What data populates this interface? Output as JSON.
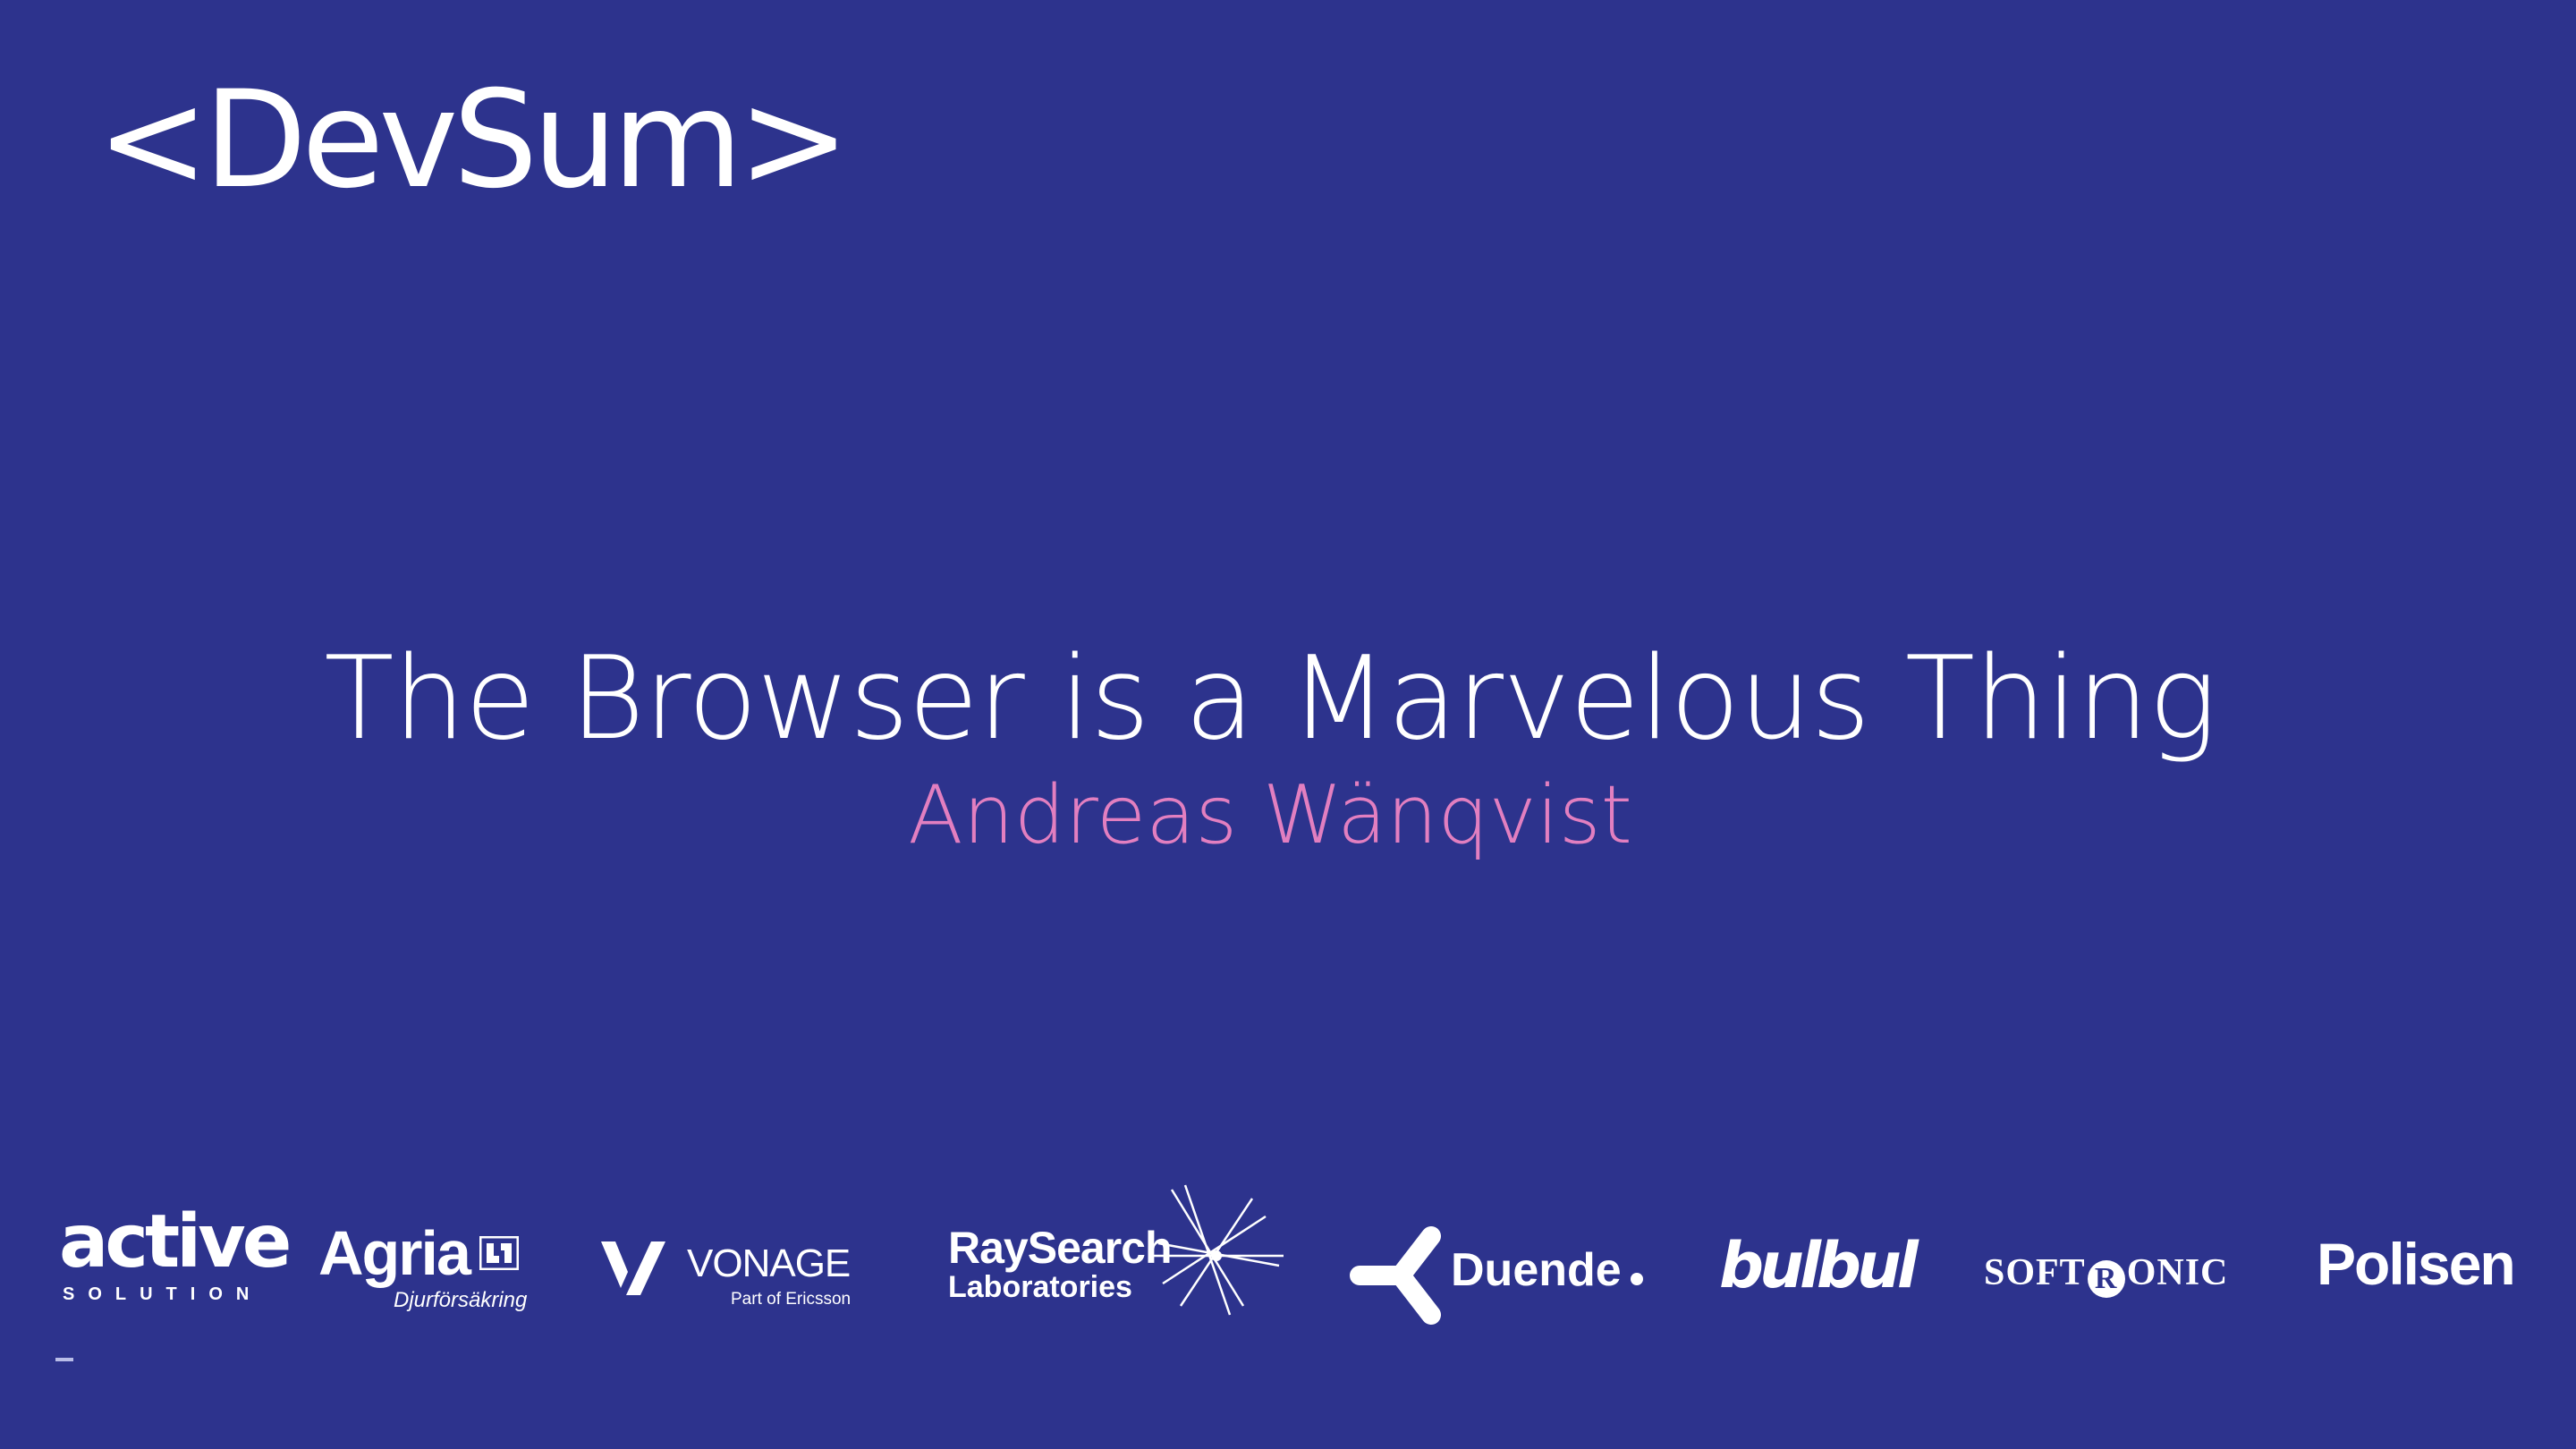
{
  "slide": {
    "background_color": "#2d338d",
    "accent_color": "#e27fc0",
    "brand": "<DevSum>",
    "title": "The Browser is a Marvelous Thing",
    "speaker": "Andreas Wänqvist"
  },
  "sponsors": [
    {
      "name": "active",
      "sub": "SOLUTION",
      "icon": "active-solution-logo"
    },
    {
      "name": "Agria",
      "sub": "Djurförsäkring",
      "icon": "agria-logo"
    },
    {
      "name": "VONAGE",
      "sub": "Part of Ericsson",
      "icon": "vonage-logo"
    },
    {
      "name": "RaySearch",
      "sub": "Laboratories",
      "icon": "raysearch-logo"
    },
    {
      "name": "Duende",
      "icon": "duende-logo"
    },
    {
      "name": "bulbul",
      "icon": "bulbul-logo"
    },
    {
      "name_pre": "SOFT",
      "name_mid": "R",
      "name_post": "ONIC",
      "icon": "softronic-logo"
    },
    {
      "name": "Polisen",
      "icon": "polisen-logo"
    }
  ]
}
